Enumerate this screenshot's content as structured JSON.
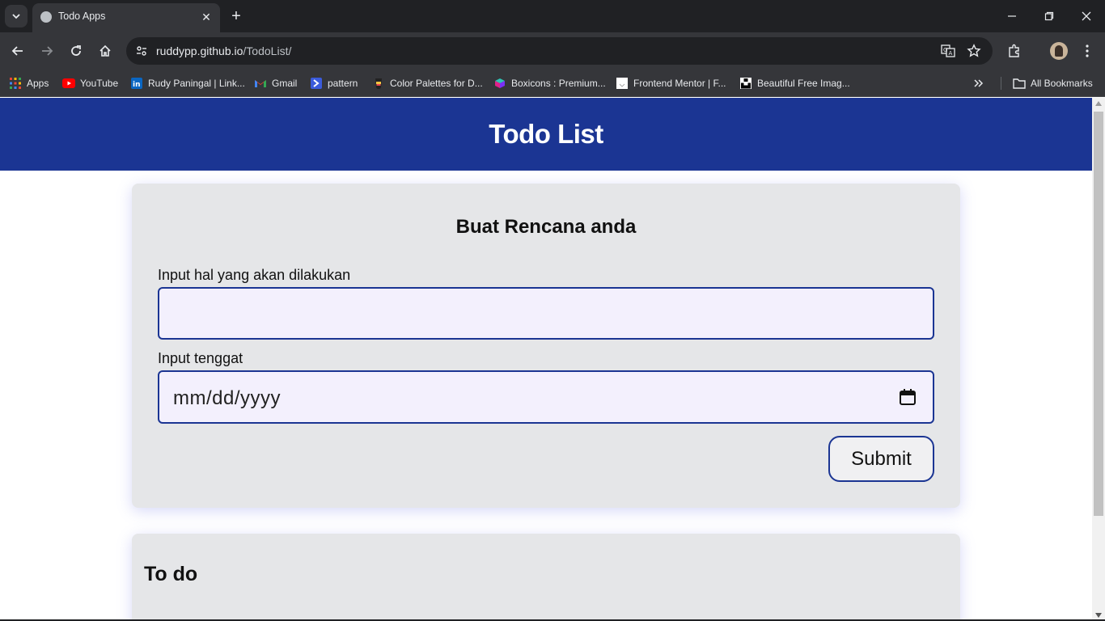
{
  "browser": {
    "tab": {
      "title": "Todo Apps",
      "favicon": "globe-icon"
    },
    "url_domain": "ruddypp.github.io",
    "url_path": "/TodoList/",
    "bookmarks": [
      {
        "label": "Apps",
        "icon": "apps-grid-icon"
      },
      {
        "label": "YouTube",
        "icon": "youtube-icon"
      },
      {
        "label": "Rudy Paningal | Link...",
        "icon": "linkedin-icon"
      },
      {
        "label": "Gmail",
        "icon": "gmail-icon"
      },
      {
        "label": "pattern",
        "icon": "pattern-icon"
      },
      {
        "label": "Color Palettes for D...",
        "icon": "palette-icon"
      },
      {
        "label": "Boxicons : Premium...",
        "icon": "boxicons-icon"
      },
      {
        "label": "Frontend Mentor | F...",
        "icon": "frontend-mentor-icon"
      },
      {
        "label": "Beautiful Free Imag...",
        "icon": "unsplash-icon"
      }
    ],
    "all_bookmarks": "All Bookmarks"
  },
  "page": {
    "title": "Todo List",
    "form": {
      "heading": "Buat Rencana anda",
      "task_label": "Input hal yang akan dilakukan",
      "task_value": "",
      "deadline_label": "Input tenggat",
      "deadline_placeholder": "mm/dd/yyyy",
      "submit_label": "Submit"
    },
    "todo": {
      "heading": "To do"
    }
  },
  "colors": {
    "header_bg": "#1b3593",
    "card_bg": "#e5e6e8",
    "input_bg": "#f3f0fd",
    "accent_border": "#1b3593"
  }
}
